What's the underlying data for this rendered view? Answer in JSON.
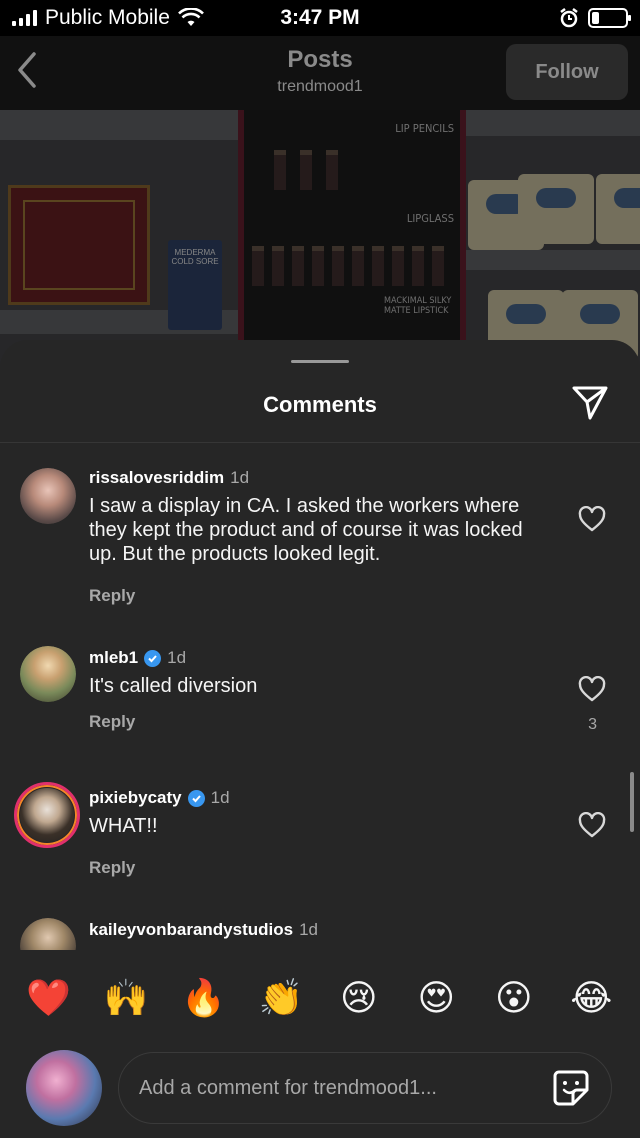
{
  "status_bar": {
    "carrier": "Public Mobile",
    "time": "3:47 PM"
  },
  "header": {
    "title": "Posts",
    "subtitle": "trendmood1",
    "follow_label": "Follow"
  },
  "photo": {
    "labels": [
      "LIP PENCILS",
      "LIPGLASS",
      "MACKIMAL SILKY MATTE LIPSTICK"
    ],
    "product_label": "MEDERMA COLD SORE"
  },
  "sheet": {
    "title": "Comments"
  },
  "comments": [
    {
      "username": "rissalovesriddim",
      "time": "1d",
      "verified": false,
      "text": "I saw a display in CA. I asked the workers where they kept the product and of course it was locked up. But the products looked legit.",
      "reply_label": "Reply",
      "likes": ""
    },
    {
      "username": "mleb1",
      "time": "1d",
      "verified": true,
      "text": "It's called diversion",
      "reply_label": "Reply",
      "likes": "3"
    },
    {
      "username": "pixiebycaty",
      "time": "1d",
      "verified": true,
      "text": "WHAT!!",
      "reply_label": "Reply",
      "likes": ""
    },
    {
      "username": "kaileyvonbarandystudios",
      "time": "1d",
      "verified": false,
      "text": "",
      "reply_label": "",
      "likes": ""
    }
  ],
  "emoji_bar": [
    "❤️",
    "🙌",
    "🔥",
    "👏",
    "😢",
    "😍",
    "😮",
    "😂"
  ],
  "composer": {
    "placeholder": "Add a comment for trendmood1..."
  },
  "colors": {
    "sheet_bg": "#262626",
    "verified_blue": "#3897f0",
    "story_ring": "#e1306c"
  }
}
